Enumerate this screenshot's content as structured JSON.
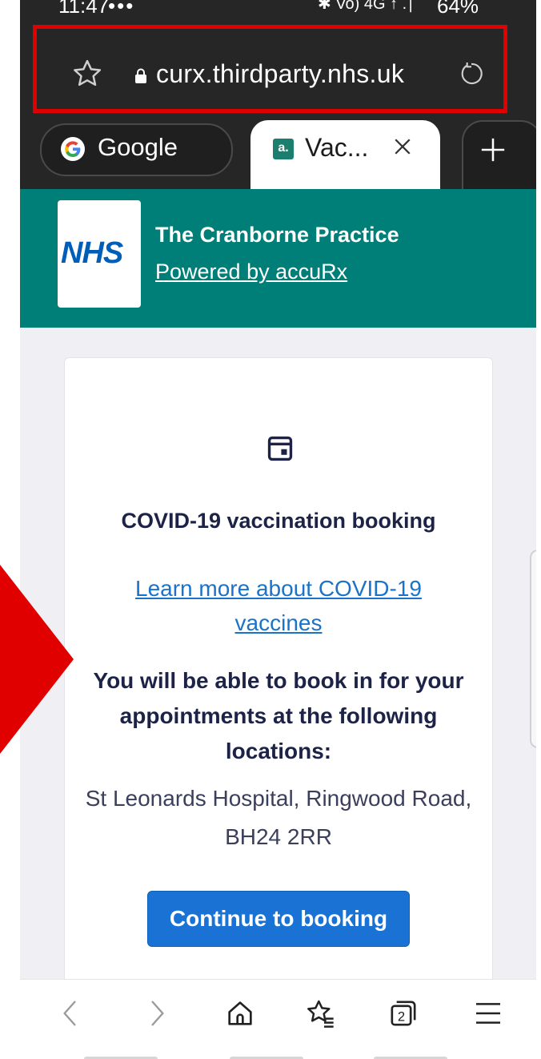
{
  "status_bar": {
    "time": "11:47",
    "left_icons": "•••",
    "right_icons": "✱ Vo) 4G ↑ .∣",
    "battery": "64%"
  },
  "browser": {
    "url": "curx.thirdparty.nhs.uk",
    "tabs": [
      {
        "label": "Google",
        "icon": "google-icon"
      },
      {
        "label": "Vac...",
        "icon": "accurx-favicon",
        "favicon_text": "a.",
        "active": true
      }
    ],
    "new_tab_icon": "plus-icon"
  },
  "header": {
    "logo_text": "NHS",
    "practice_name": "The Cranborne Practice",
    "powered_by": "Powered by accuRx"
  },
  "card": {
    "icon": "calendar-icon",
    "title": "COVID-19 vaccination booking",
    "learn_more": "Learn more about COVID-19 vaccines",
    "locations_heading": "You will be able to book in for your appointments at the following locations:",
    "address": "St Leonards Hospital, Ringwood Road, BH24 2RR",
    "continue_label": "Continue to booking"
  },
  "bottom_nav": {
    "items": [
      "back-icon",
      "forward-icon",
      "home-icon",
      "bookmarks-icon",
      "tabs-icon",
      "menu-icon"
    ],
    "tab_count": "2"
  },
  "colors": {
    "nhs_teal": "#007f78",
    "nhs_blue": "#005eb8",
    "button_blue": "#1a73d4",
    "annotation_red": "#e00000"
  }
}
